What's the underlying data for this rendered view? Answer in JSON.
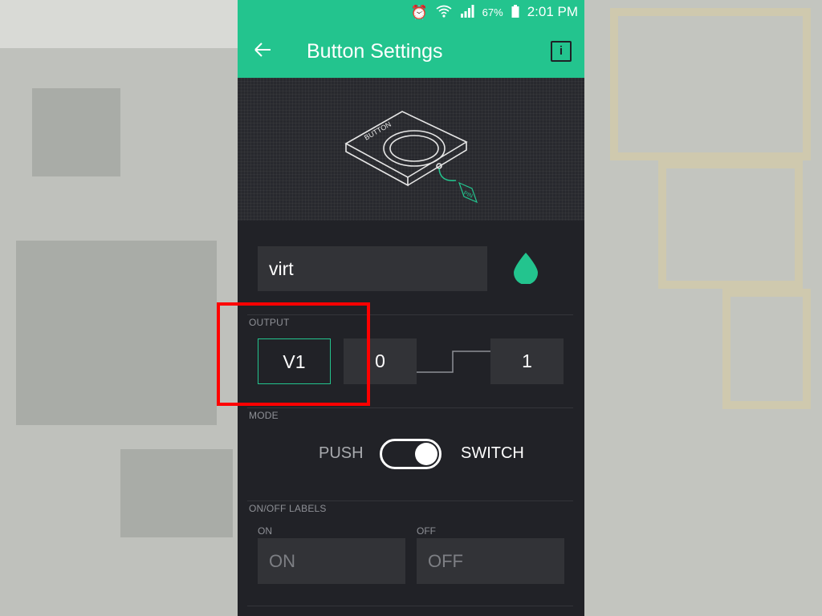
{
  "status_bar": {
    "battery": "67%",
    "time": "2:01 PM",
    "alarm_icon": "alarm-icon",
    "wifi_icon": "wifi-icon",
    "signal_icon": "signal-icon",
    "battery_icon": "battery-icon"
  },
  "app_bar": {
    "back_icon": "arrow-left-icon",
    "title": "Button Settings",
    "info_label": "i"
  },
  "hero": {
    "illustration_label": "BUTTON",
    "pin_label": "PIN"
  },
  "widget": {
    "name_value": "virt",
    "color_icon": "droplet-icon",
    "color": "#23c48e"
  },
  "output": {
    "section_label": "OUTPUT",
    "pin_value": "V1",
    "low_value": "0",
    "high_value": "1"
  },
  "mode": {
    "section_label": "MODE",
    "push_label": "PUSH",
    "switch_label": "SWITCH",
    "selected": "SWITCH"
  },
  "labels": {
    "section_label": "ON/OFF LABELS",
    "on_caption": "ON",
    "on_placeholder": "ON",
    "off_caption": "OFF",
    "off_placeholder": "OFF"
  },
  "colors": {
    "accent": "#23c48e",
    "panel": "#212227",
    "field": "#323337",
    "highlight": "#ff0000"
  }
}
